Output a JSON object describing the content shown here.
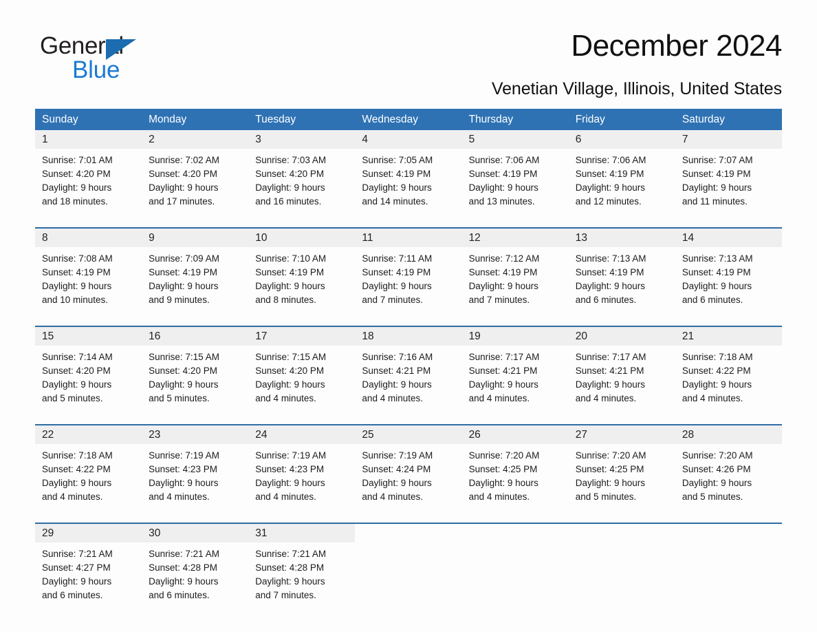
{
  "brand": {
    "line1": "General",
    "line2": "Blue",
    "triangle_color": "#1b6cb0",
    "line2_color": "#1b7ad4"
  },
  "header": {
    "month_title": "December 2024",
    "location": "Venetian Village, Illinois, United States"
  },
  "theme": {
    "header_blue": "#2e72b4",
    "separator_blue": "#2e6da4",
    "date_band_gray": "#efefef",
    "page_background": "#fdfdfd"
  },
  "weekdays": [
    "Sunday",
    "Monday",
    "Tuesday",
    "Wednesday",
    "Thursday",
    "Friday",
    "Saturday"
  ],
  "weeks": [
    {
      "days": [
        {
          "date": "1",
          "sunrise": "Sunrise: 7:01 AM",
          "sunset": "Sunset: 4:20 PM",
          "daylight_1": "Daylight: 9 hours",
          "daylight_2": "and 18 minutes."
        },
        {
          "date": "2",
          "sunrise": "Sunrise: 7:02 AM",
          "sunset": "Sunset: 4:20 PM",
          "daylight_1": "Daylight: 9 hours",
          "daylight_2": "and 17 minutes."
        },
        {
          "date": "3",
          "sunrise": "Sunrise: 7:03 AM",
          "sunset": "Sunset: 4:20 PM",
          "daylight_1": "Daylight: 9 hours",
          "daylight_2": "and 16 minutes."
        },
        {
          "date": "4",
          "sunrise": "Sunrise: 7:05 AM",
          "sunset": "Sunset: 4:19 PM",
          "daylight_1": "Daylight: 9 hours",
          "daylight_2": "and 14 minutes."
        },
        {
          "date": "5",
          "sunrise": "Sunrise: 7:06 AM",
          "sunset": "Sunset: 4:19 PM",
          "daylight_1": "Daylight: 9 hours",
          "daylight_2": "and 13 minutes."
        },
        {
          "date": "6",
          "sunrise": "Sunrise: 7:06 AM",
          "sunset": "Sunset: 4:19 PM",
          "daylight_1": "Daylight: 9 hours",
          "daylight_2": "and 12 minutes."
        },
        {
          "date": "7",
          "sunrise": "Sunrise: 7:07 AM",
          "sunset": "Sunset: 4:19 PM",
          "daylight_1": "Daylight: 9 hours",
          "daylight_2": "and 11 minutes."
        }
      ]
    },
    {
      "days": [
        {
          "date": "8",
          "sunrise": "Sunrise: 7:08 AM",
          "sunset": "Sunset: 4:19 PM",
          "daylight_1": "Daylight: 9 hours",
          "daylight_2": "and 10 minutes."
        },
        {
          "date": "9",
          "sunrise": "Sunrise: 7:09 AM",
          "sunset": "Sunset: 4:19 PM",
          "daylight_1": "Daylight: 9 hours",
          "daylight_2": "and 9 minutes."
        },
        {
          "date": "10",
          "sunrise": "Sunrise: 7:10 AM",
          "sunset": "Sunset: 4:19 PM",
          "daylight_1": "Daylight: 9 hours",
          "daylight_2": "and 8 minutes."
        },
        {
          "date": "11",
          "sunrise": "Sunrise: 7:11 AM",
          "sunset": "Sunset: 4:19 PM",
          "daylight_1": "Daylight: 9 hours",
          "daylight_2": "and 7 minutes."
        },
        {
          "date": "12",
          "sunrise": "Sunrise: 7:12 AM",
          "sunset": "Sunset: 4:19 PM",
          "daylight_1": "Daylight: 9 hours",
          "daylight_2": "and 7 minutes."
        },
        {
          "date": "13",
          "sunrise": "Sunrise: 7:13 AM",
          "sunset": "Sunset: 4:19 PM",
          "daylight_1": "Daylight: 9 hours",
          "daylight_2": "and 6 minutes."
        },
        {
          "date": "14",
          "sunrise": "Sunrise: 7:13 AM",
          "sunset": "Sunset: 4:19 PM",
          "daylight_1": "Daylight: 9 hours",
          "daylight_2": "and 6 minutes."
        }
      ]
    },
    {
      "days": [
        {
          "date": "15",
          "sunrise": "Sunrise: 7:14 AM",
          "sunset": "Sunset: 4:20 PM",
          "daylight_1": "Daylight: 9 hours",
          "daylight_2": "and 5 minutes."
        },
        {
          "date": "16",
          "sunrise": "Sunrise: 7:15 AM",
          "sunset": "Sunset: 4:20 PM",
          "daylight_1": "Daylight: 9 hours",
          "daylight_2": "and 5 minutes."
        },
        {
          "date": "17",
          "sunrise": "Sunrise: 7:15 AM",
          "sunset": "Sunset: 4:20 PM",
          "daylight_1": "Daylight: 9 hours",
          "daylight_2": "and 4 minutes."
        },
        {
          "date": "18",
          "sunrise": "Sunrise: 7:16 AM",
          "sunset": "Sunset: 4:21 PM",
          "daylight_1": "Daylight: 9 hours",
          "daylight_2": "and 4 minutes."
        },
        {
          "date": "19",
          "sunrise": "Sunrise: 7:17 AM",
          "sunset": "Sunset: 4:21 PM",
          "daylight_1": "Daylight: 9 hours",
          "daylight_2": "and 4 minutes."
        },
        {
          "date": "20",
          "sunrise": "Sunrise: 7:17 AM",
          "sunset": "Sunset: 4:21 PM",
          "daylight_1": "Daylight: 9 hours",
          "daylight_2": "and 4 minutes."
        },
        {
          "date": "21",
          "sunrise": "Sunrise: 7:18 AM",
          "sunset": "Sunset: 4:22 PM",
          "daylight_1": "Daylight: 9 hours",
          "daylight_2": "and 4 minutes."
        }
      ]
    },
    {
      "days": [
        {
          "date": "22",
          "sunrise": "Sunrise: 7:18 AM",
          "sunset": "Sunset: 4:22 PM",
          "daylight_1": "Daylight: 9 hours",
          "daylight_2": "and 4 minutes."
        },
        {
          "date": "23",
          "sunrise": "Sunrise: 7:19 AM",
          "sunset": "Sunset: 4:23 PM",
          "daylight_1": "Daylight: 9 hours",
          "daylight_2": "and 4 minutes."
        },
        {
          "date": "24",
          "sunrise": "Sunrise: 7:19 AM",
          "sunset": "Sunset: 4:23 PM",
          "daylight_1": "Daylight: 9 hours",
          "daylight_2": "and 4 minutes."
        },
        {
          "date": "25",
          "sunrise": "Sunrise: 7:19 AM",
          "sunset": "Sunset: 4:24 PM",
          "daylight_1": "Daylight: 9 hours",
          "daylight_2": "and 4 minutes."
        },
        {
          "date": "26",
          "sunrise": "Sunrise: 7:20 AM",
          "sunset": "Sunset: 4:25 PM",
          "daylight_1": "Daylight: 9 hours",
          "daylight_2": "and 4 minutes."
        },
        {
          "date": "27",
          "sunrise": "Sunrise: 7:20 AM",
          "sunset": "Sunset: 4:25 PM",
          "daylight_1": "Daylight: 9 hours",
          "daylight_2": "and 5 minutes."
        },
        {
          "date": "28",
          "sunrise": "Sunrise: 7:20 AM",
          "sunset": "Sunset: 4:26 PM",
          "daylight_1": "Daylight: 9 hours",
          "daylight_2": "and 5 minutes."
        }
      ]
    },
    {
      "days": [
        {
          "date": "29",
          "sunrise": "Sunrise: 7:21 AM",
          "sunset": "Sunset: 4:27 PM",
          "daylight_1": "Daylight: 9 hours",
          "daylight_2": "and 6 minutes."
        },
        {
          "date": "30",
          "sunrise": "Sunrise: 7:21 AM",
          "sunset": "Sunset: 4:28 PM",
          "daylight_1": "Daylight: 9 hours",
          "daylight_2": "and 6 minutes."
        },
        {
          "date": "31",
          "sunrise": "Sunrise: 7:21 AM",
          "sunset": "Sunset: 4:28 PM",
          "daylight_1": "Daylight: 9 hours",
          "daylight_2": "and 7 minutes."
        },
        {
          "date": "",
          "sunrise": "",
          "sunset": "",
          "daylight_1": "",
          "daylight_2": ""
        },
        {
          "date": "",
          "sunrise": "",
          "sunset": "",
          "daylight_1": "",
          "daylight_2": ""
        },
        {
          "date": "",
          "sunrise": "",
          "sunset": "",
          "daylight_1": "",
          "daylight_2": ""
        },
        {
          "date": "",
          "sunrise": "",
          "sunset": "",
          "daylight_1": "",
          "daylight_2": ""
        }
      ]
    }
  ]
}
